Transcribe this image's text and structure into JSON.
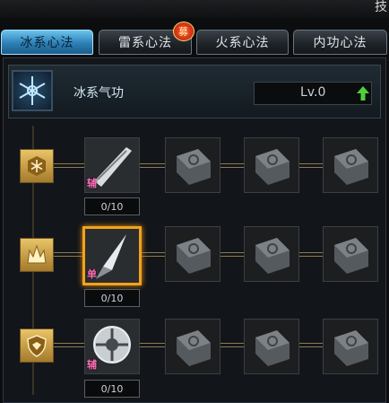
{
  "window": {
    "title_partial": "技"
  },
  "tabs": [
    {
      "label": "冰系心法",
      "active": true
    },
    {
      "label": "雷系心法",
      "active": false,
      "badge": "募"
    },
    {
      "label": "火系心法",
      "active": false
    },
    {
      "label": "内功心法",
      "active": false
    }
  ],
  "header": {
    "title": "冰系气功",
    "level": "Lv.0"
  },
  "rows": [
    {
      "category_icon": "snowflake-emblem-icon",
      "skill_icon": "ice-sword-skill-icon",
      "tag": "辅",
      "count": "0/10"
    },
    {
      "category_icon": "flame-crown-emblem-icon",
      "skill_icon": "ice-spear-skill-icon",
      "tag": "单",
      "count": "0/10",
      "highlight": true
    },
    {
      "category_icon": "shield-emblem-icon",
      "skill_icon": "ice-wheel-skill-icon",
      "tag": "辅",
      "count": "0/10"
    }
  ],
  "colors": {
    "active_tab": "#4aa7d9",
    "highlight": "#f2a21c",
    "level_arrow": "#4fd03a",
    "emblem_gold": "#d7ae55"
  }
}
